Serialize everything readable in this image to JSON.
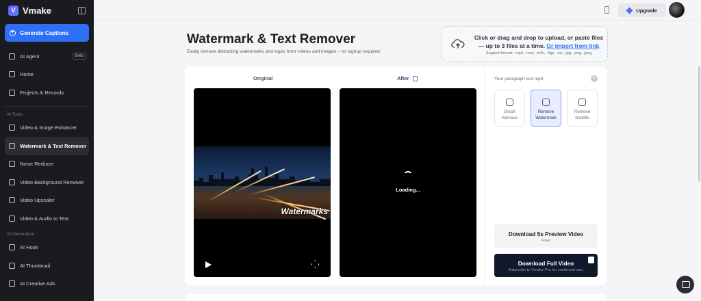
{
  "sidebar": {
    "brand": "Vmake",
    "logo_letter": "V",
    "primary_button": "Generate Captions",
    "items_top": [
      {
        "label": "AI Agent",
        "badge": "Beta"
      },
      {
        "label": "Home"
      },
      {
        "label": "Projects & Records"
      }
    ],
    "section_tools": "AI Tools",
    "items_tools": [
      {
        "label": "Video & Image Enhancer"
      },
      {
        "label": "Watermark & Text Remover",
        "active": true
      },
      {
        "label": "Noise Reducer"
      },
      {
        "label": "Video Background Remover"
      },
      {
        "label": "Video Upscaler"
      },
      {
        "label": "Video & Audio to Text"
      }
    ],
    "section_gen": "AI Generation",
    "items_gen": [
      {
        "label": "AI Hook"
      },
      {
        "label": "AI Thumbnail"
      },
      {
        "label": "AI Creative Ads"
      }
    ]
  },
  "topbar": {
    "upgrade_label": "Upgrade"
  },
  "main": {
    "title": "Watermark & Text Remover",
    "subtitle": "Easily remove distracting watermarks and logos from videos and images – no signup required.",
    "upload": {
      "text": "Click or drag and drop to upload, or paste files — up to 3 files at a time.",
      "link": "Or import from link",
      "formats": "Support format: .mp4, .mov, .m4v, .3gp, .avi, .jpg, .png, .jpeg"
    },
    "labels": {
      "original": "Original",
      "after": "After"
    },
    "watermark_text": "Watermarks",
    "loading": "Loading...",
    "panel": {
      "file_name": "Your paragraph text.mp4",
      "tools": [
        {
          "label1": "Smart",
          "label2": "Remove"
        },
        {
          "label1": "Remove",
          "label2": "Watermark",
          "selected": true
        },
        {
          "label1": "Remove",
          "label2": "Subtitle"
        }
      ],
      "preview_btn": "Download 5s Preview Video",
      "preview_sub": "Free!",
      "full_btn": "Download Full Video",
      "full_sub": "Subscribe to Vmake Pro for continued use."
    }
  },
  "colors": {
    "accent": "#2f6ff5",
    "sidebar_bg": "#1a1b1e",
    "dark_button": "#12182b"
  }
}
